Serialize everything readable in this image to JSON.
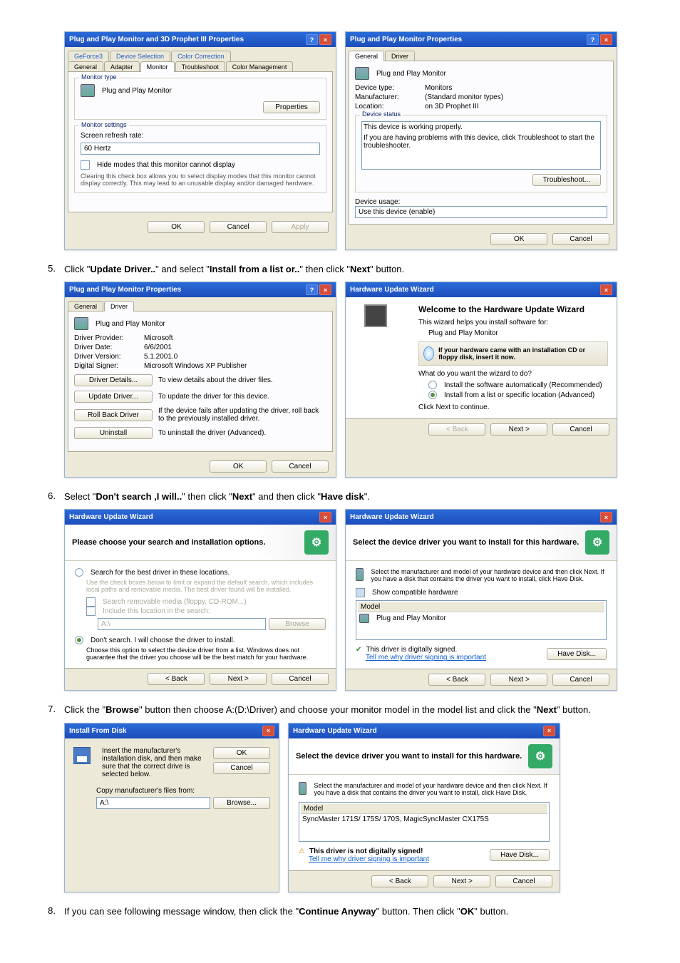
{
  "fig1a": {
    "title": "Plug and Play Monitor and 3D Prophet III Properties",
    "tabs_top": [
      "GeForce3",
      "Device Selection",
      "Color Correction"
    ],
    "tabs_bot": [
      "General",
      "Adapter",
      "Monitor",
      "Troubleshoot",
      "Color Management"
    ],
    "grp_monitor_type": "Monitor type",
    "monitor_name": "Plug and Play Monitor",
    "btn_properties": "Properties",
    "grp_settings": "Monitor settings",
    "lbl_refresh": "Screen refresh rate:",
    "refresh_val": "60 Hertz",
    "chk_hide": "Hide modes that this monitor cannot display",
    "hide_desc": "Clearing this check box allows you to select display modes that this monitor cannot display correctly. This may lead to an unusable display and/or damaged hardware.",
    "btn_ok": "OK",
    "btn_cancel": "Cancel",
    "btn_apply": "Apply"
  },
  "fig1b": {
    "title": "Plug and Play Monitor Properties",
    "tabs": [
      "General",
      "Driver"
    ],
    "name": "Plug and Play Monitor",
    "kv_type_l": "Device type:",
    "kv_type_v": "Monitors",
    "kv_man_l": "Manufacturer:",
    "kv_man_v": "(Standard monitor types)",
    "kv_loc_l": "Location:",
    "kv_loc_v": "on 3D Prophet III",
    "grp_status": "Device status",
    "status_line1": "This device is working properly.",
    "status_line2": "If you are having problems with this device, click Troubleshoot to start the troubleshooter.",
    "btn_trouble": "Troubleshoot...",
    "lbl_usage": "Device usage:",
    "usage_val": "Use this device (enable)",
    "btn_ok": "OK",
    "btn_cancel": "Cancel"
  },
  "step5": "Click \"Update Driver..\" and select \"Install from a list or..\" then click \"Next\" button.",
  "fig2a": {
    "title": "Plug and Play Monitor Properties",
    "tabs": [
      "General",
      "Driver"
    ],
    "name": "Plug and Play Monitor",
    "kv_prov_l": "Driver Provider:",
    "kv_prov_v": "Microsoft",
    "kv_date_l": "Driver Date:",
    "kv_date_v": "6/6/2001",
    "kv_ver_l": "Driver Version:",
    "kv_ver_v": "5.1.2001.0",
    "kv_sign_l": "Digital Signer:",
    "kv_sign_v": "Microsoft Windows XP Publisher",
    "btn_details": "Driver Details...",
    "desc_details": "To view details about the driver files.",
    "btn_update": "Update Driver...",
    "desc_update": "To update the driver for this device.",
    "btn_roll": "Roll Back Driver",
    "desc_roll": "If the device fails after updating the driver, roll back to the previously installed driver.",
    "btn_uninst": "Uninstall",
    "desc_uninst": "To uninstall the driver (Advanced).",
    "btn_ok": "OK",
    "btn_cancel": "Cancel"
  },
  "fig2b": {
    "title": "Hardware Update Wizard",
    "heading": "Welcome to the Hardware Update Wizard",
    "line1": "This wizard helps you install software for:",
    "dev": "Plug and Play Monitor",
    "cd": "If your hardware came with an installation CD or floppy disk, insert it now.",
    "q": "What do you want the wizard to do?",
    "opt1": "Install the software automatically (Recommended)",
    "opt2": "Install from a list or specific location (Advanced)",
    "cont": "Click Next to continue.",
    "btn_back": "< Back",
    "btn_next": "Next >",
    "btn_cancel": "Cancel"
  },
  "step6": "Select \"Don't search ,I will..\" then click \"Next\" and then click \"Have disk\".",
  "fig3a": {
    "title": "Hardware Update Wizard",
    "heading": "Please choose your search and installation options.",
    "opt1": "Search for the best driver in these locations.",
    "opt1_desc": "Use the check boxes below to limit or expand the default search, which includes local paths and removable media. The best driver found will be installed.",
    "chk1": "Search removable media (floppy, CD-ROM...)",
    "chk2": "Include this location in the search:",
    "path": "A:\\",
    "btn_browse": "Browse",
    "opt2": "Don't search. I will choose the driver to install.",
    "opt2_desc": "Choose this option to select the device driver from a list. Windows does not guarantee that the driver you choose will be the best match for your hardware.",
    "btn_back": "< Back",
    "btn_next": "Next >",
    "btn_cancel": "Cancel"
  },
  "fig3b": {
    "title": "Hardware Update Wizard",
    "heading": "Select the device driver you want to install for this hardware.",
    "desc": "Select the manufacturer and model of your hardware device and then click Next. If you have a disk that contains the driver you want to install, click Have Disk.",
    "chk_compat": "Show compatible hardware",
    "model_lbl": "Model",
    "model_item": "Plug and Play Monitor",
    "signed": "This driver is digitally signed.",
    "tell": "Tell me why driver signing is important",
    "btn_have": "Have Disk...",
    "btn_back": "< Back",
    "btn_next": "Next >",
    "btn_cancel": "Cancel"
  },
  "step7": "Click the \"Browse\" button then choose A:(D:\\Driver) and choose your monitor model in the model list and click the \"Next\" button.",
  "fig4a": {
    "title": "Install From Disk",
    "msg": "Insert the manufacturer's installation disk, and then make sure that the correct drive is selected below.",
    "btn_ok": "OK",
    "btn_cancel": "Cancel",
    "lbl_copy": "Copy manufacturer's files from:",
    "path": "A:\\",
    "btn_browse": "Browse..."
  },
  "fig4b": {
    "title": "Hardware Update Wizard",
    "heading": "Select the device driver you want to install for this hardware.",
    "desc": "Select the manufacturer and model of your hardware device and then click Next. If you have a disk that contains the driver you want to install, click Have Disk.",
    "model_lbl": "Model",
    "model_item": "SyncMaster 171S/ 175S/ 170S, MagicSyncMaster CX175S",
    "notsigned": "This driver is not digitally signed!",
    "tell": "Tell me why driver signing is important",
    "btn_have": "Have Disk...",
    "btn_back": "< Back",
    "btn_next": "Next >",
    "btn_cancel": "Cancel"
  },
  "step8": "If you can see following message window, then click the \"Continue Anyway\" button. Then click \"OK\" button."
}
